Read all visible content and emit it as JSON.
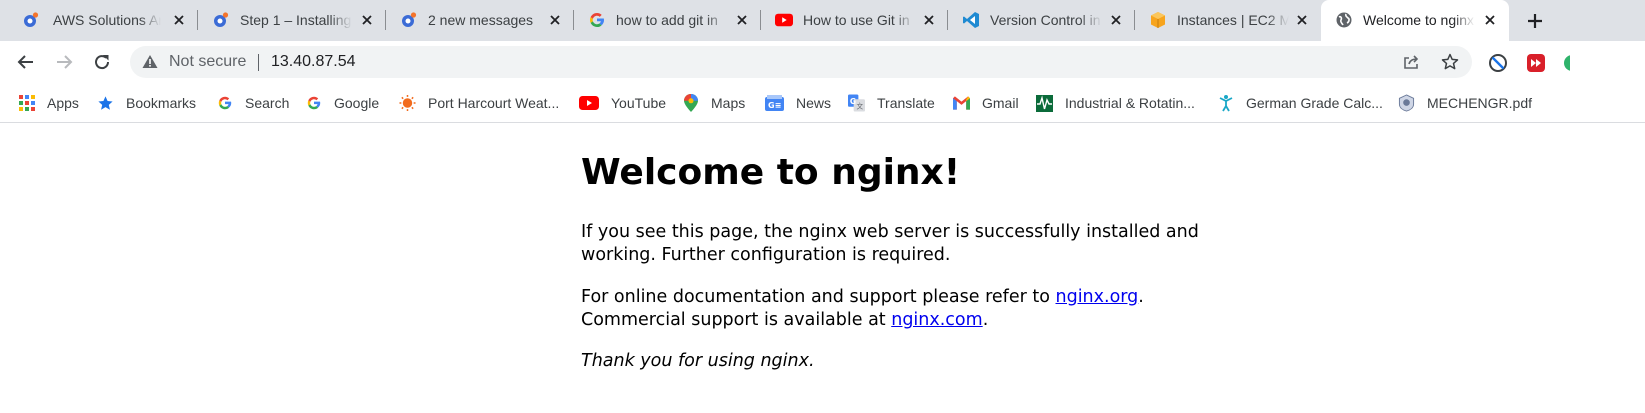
{
  "tabs": [
    {
      "title": "AWS Solutions Ar",
      "icon": "orange-app-icon",
      "active": false
    },
    {
      "title": "Step 1 – Installing",
      "icon": "orange-app-icon",
      "active": false
    },
    {
      "title": "2 new messages",
      "icon": "orange-app-icon",
      "active": false
    },
    {
      "title": "how to add git in",
      "icon": "google-icon",
      "active": false
    },
    {
      "title": "How to use Git in",
      "icon": "youtube-icon",
      "active": false
    },
    {
      "title": "Version Control in",
      "icon": "vscode-icon",
      "active": false
    },
    {
      "title": "Instances | EC2 M",
      "icon": "aws-icon",
      "active": false
    },
    {
      "title": "Welcome to nginx",
      "icon": "globe-icon",
      "active": true
    }
  ],
  "omnibox": {
    "security_label": "Not secure",
    "url": "13.40.87.54"
  },
  "bookmarks": [
    {
      "label": "Apps",
      "icon": "apps-grid-icon"
    },
    {
      "label": "Bookmarks",
      "icon": "star-icon"
    },
    {
      "label": "Search",
      "icon": "google-icon"
    },
    {
      "label": "Google",
      "icon": "google-icon"
    },
    {
      "label": "Port Harcourt Weat...",
      "icon": "sun-icon"
    },
    {
      "label": "YouTube",
      "icon": "youtube-icon"
    },
    {
      "label": "Maps",
      "icon": "maps-pin-icon"
    },
    {
      "label": "News",
      "icon": "news-icon"
    },
    {
      "label": "Translate",
      "icon": "translate-icon"
    },
    {
      "label": "Gmail",
      "icon": "gmail-icon"
    },
    {
      "label": "Industrial & Rotatin...",
      "icon": "pulse-icon"
    },
    {
      "label": "German Grade Calc...",
      "icon": "figure-icon"
    },
    {
      "label": "MECHENGR.pdf",
      "icon": "badge-icon"
    }
  ],
  "page": {
    "heading": "Welcome to nginx!",
    "para1_line1": "If you see this page, the nginx web server is successfully installed and",
    "para1_line2": "working. Further configuration is required.",
    "para2_prefix": "For online documentation and support please refer to ",
    "para2_link": "nginx.org",
    "para2_suffix": ".",
    "para3_prefix": "Commercial support is available at ",
    "para3_link": "nginx.com",
    "para3_suffix": ".",
    "thanks": "Thank you for using nginx."
  },
  "colors": {
    "tabstrip_bg": "#dee1e6",
    "omnibox_bg": "#f1f3f4",
    "link": "#0000ee"
  }
}
